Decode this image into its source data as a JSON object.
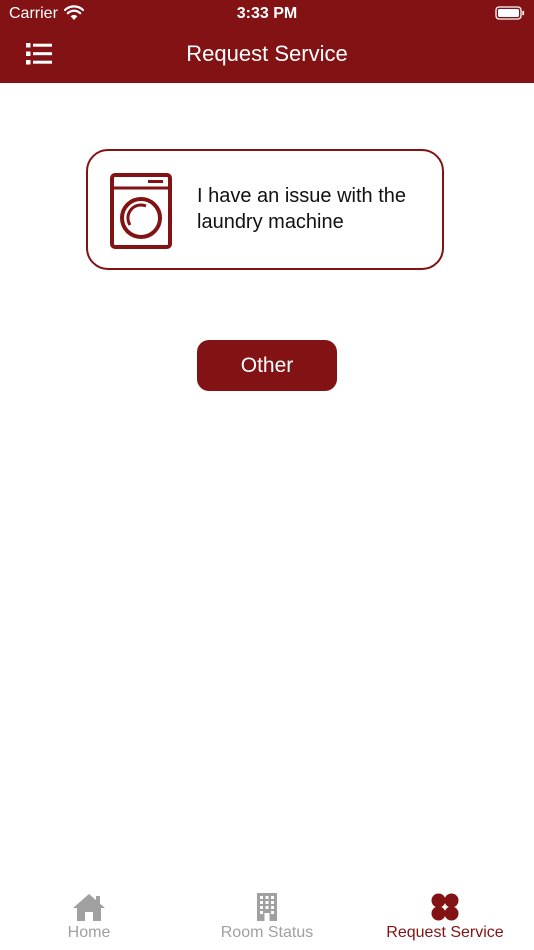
{
  "status_bar": {
    "carrier": "Carrier",
    "time": "3:33 PM"
  },
  "nav": {
    "title": "Request Service",
    "menu_icon": "list-icon"
  },
  "services": [
    {
      "icon": "washing-machine-icon",
      "label": "I have an issue with the laundry machine"
    }
  ],
  "other_button": {
    "label": "Other"
  },
  "tabs": [
    {
      "label": "Home",
      "icon": "home-icon",
      "active": false
    },
    {
      "label": "Room Status",
      "icon": "building-icon",
      "active": false
    },
    {
      "label": "Request Service",
      "icon": "clover-icon",
      "active": true
    }
  ],
  "colors": {
    "brand": "#821214",
    "inactive_tab": "#a0a0a0",
    "background": "#ffffff"
  }
}
